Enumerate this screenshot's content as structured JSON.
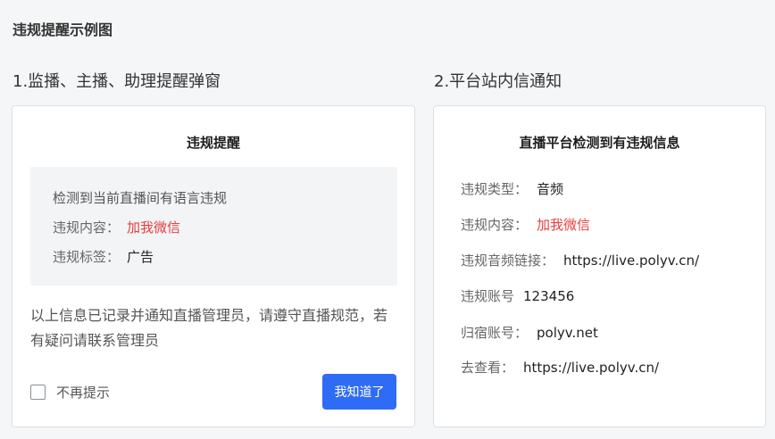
{
  "page": {
    "title": "违规提醒示例图"
  },
  "sections": {
    "left_title": "1.监播、主播、助理提醒弹窗",
    "right_title": "2.平台站内信通知"
  },
  "dialog": {
    "title": "违规提醒",
    "detected_text": "检测到当前直播间有语言违规",
    "content_label": "违规内容：",
    "content_value": "加我微信",
    "tag_label": "违规标签：",
    "tag_value": "广告",
    "notice": "以上信息已记录并通知直播管理员，请遵守直播规范，若有疑问请联系管理员",
    "checkbox_label": "不再提示",
    "confirm_label": "我知道了"
  },
  "message": {
    "title": "直播平台检测到有违规信息",
    "rows": [
      {
        "label": "违规类型：",
        "value": "音频"
      },
      {
        "label": "违规内容：",
        "value": "加我微信"
      },
      {
        "label": "违规音频链接：",
        "value": "https://live.polyv.cn/"
      },
      {
        "label": "违规账号",
        "value": "123456"
      },
      {
        "label": "归宿账号：",
        "value": "polyv.net"
      },
      {
        "label": "去查看：",
        "value": "https://live.polyv.cn/"
      }
    ]
  },
  "colors": {
    "accent": "#2f6cf6",
    "warning_red": "#e63f3f",
    "background": "#f5f6f7"
  }
}
